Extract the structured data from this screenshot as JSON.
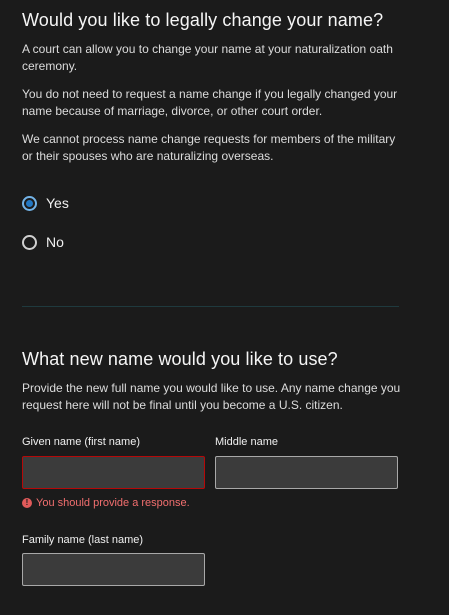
{
  "section1": {
    "title": "Would you like to legally change your name?",
    "paragraphs": [
      "A court can allow you to change your name at your naturalization oath ceremony.",
      "You do not need to request a name change if you legally changed your name because of marriage, divorce, or other court order.",
      "We cannot process name change requests for members of the military or their spouses who are naturalizing overseas."
    ],
    "options": [
      {
        "label": "Yes",
        "selected": true
      },
      {
        "label": "No",
        "selected": false
      }
    ]
  },
  "section2": {
    "title": "What new name would you like to use?",
    "description": "Provide the new full name you would like to use. Any name change you request here will not be final until you become a U.S. citizen.",
    "fields": {
      "given_name": {
        "label": "Given name (first name)",
        "value": ""
      },
      "middle_name": {
        "label": "Middle name",
        "value": ""
      },
      "family_name": {
        "label": "Family name (last name)",
        "value": ""
      }
    },
    "error": "You should provide a response."
  },
  "colors": {
    "background": "#1b1b1b",
    "accent": "#2378c3",
    "error": "#f26f6f"
  }
}
